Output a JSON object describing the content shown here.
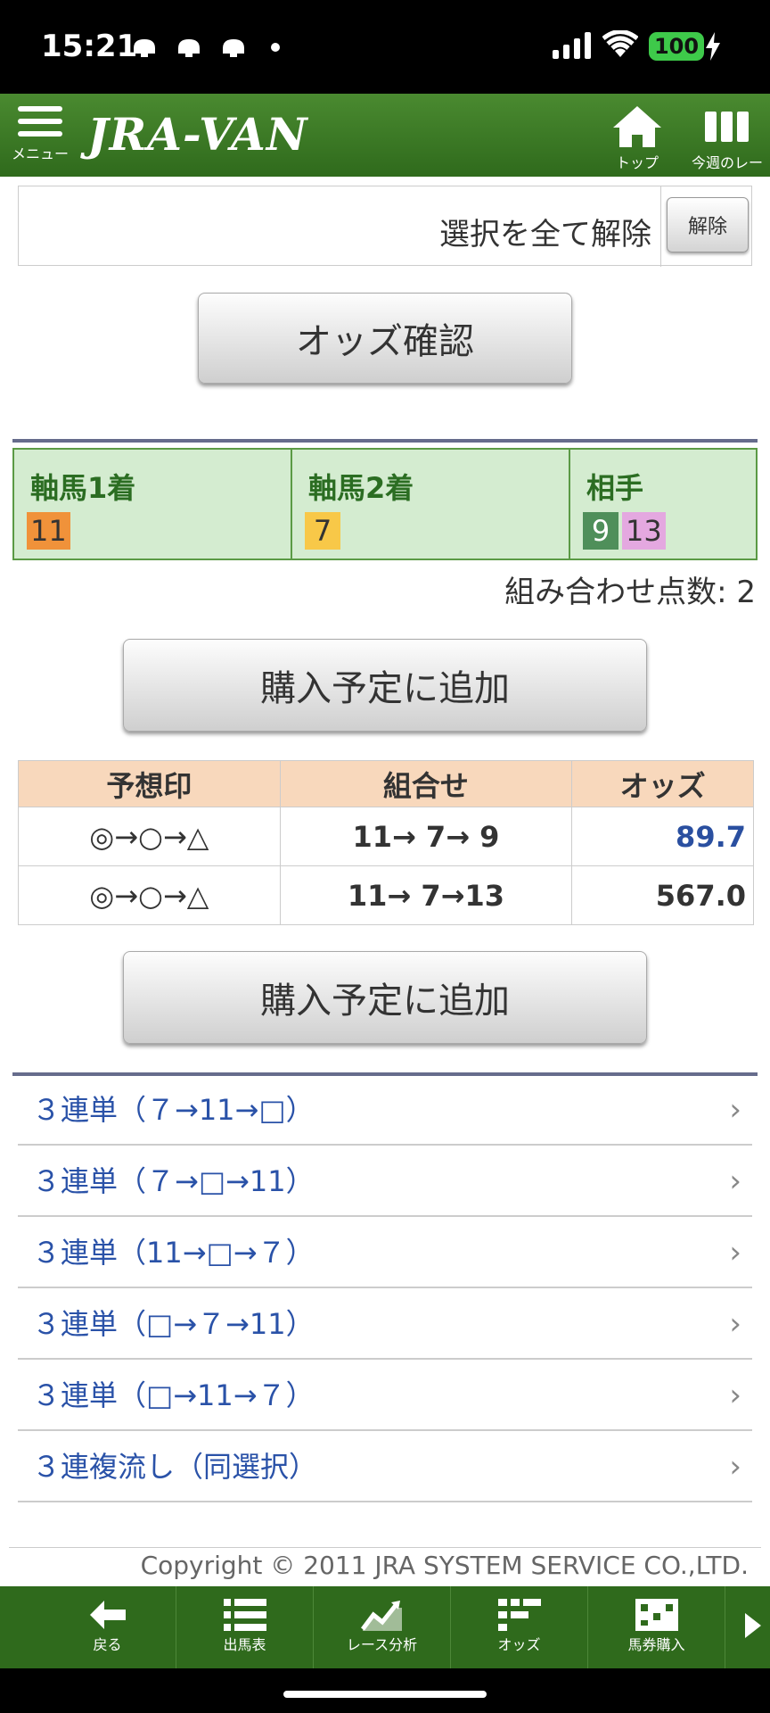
{
  "status": {
    "time": "15:21",
    "battery": "100"
  },
  "header": {
    "menu_label": "メニュー",
    "logo": "JRA-VAN",
    "top_label": "トップ",
    "week_label": "今週のレース"
  },
  "deselect": {
    "label": "選択を全て解除",
    "button": "解除"
  },
  "buttons": {
    "check_odds": "オッズ確認",
    "add_plan": "購入予定に追加"
  },
  "picks": {
    "col1": {
      "title": "軸馬1着",
      "nums": [
        "11"
      ]
    },
    "col2": {
      "title": "軸馬2着",
      "nums": [
        "7"
      ]
    },
    "col3": {
      "title": "相手",
      "nums": [
        "9",
        "13"
      ]
    }
  },
  "combo_count": "組み合わせ点数: 2",
  "table": {
    "headers": [
      "予想印",
      "組合せ",
      "オッズ"
    ],
    "rows": [
      {
        "mark": "◎→○→△",
        "combo": "11→ 7→ 9",
        "odds": "89.7"
      },
      {
        "mark": "◎→○→△",
        "combo": "11→ 7→13",
        "odds": "567.0"
      }
    ]
  },
  "links": [
    "３連単（７→11→□）",
    "３連単（７→□→11）",
    "３連単（11→□→７）",
    "３連単（□→７→11）",
    "３連単（□→11→７）",
    "３連複流し（同選択）"
  ],
  "copyright": "Copyright © 2011 JRA SYSTEM SERVICE CO.,LTD.",
  "toolbar": [
    "戻る",
    "出馬表",
    "レース分析",
    "オッズ",
    "馬券購入"
  ],
  "colors": {
    "header_green": "#2f6a1c",
    "num11": "#f0923a",
    "num7": "#f8c848",
    "num9": "#4f8f5a",
    "num13": "#e4a8e0",
    "odds_blue": "#2a4fa0"
  }
}
